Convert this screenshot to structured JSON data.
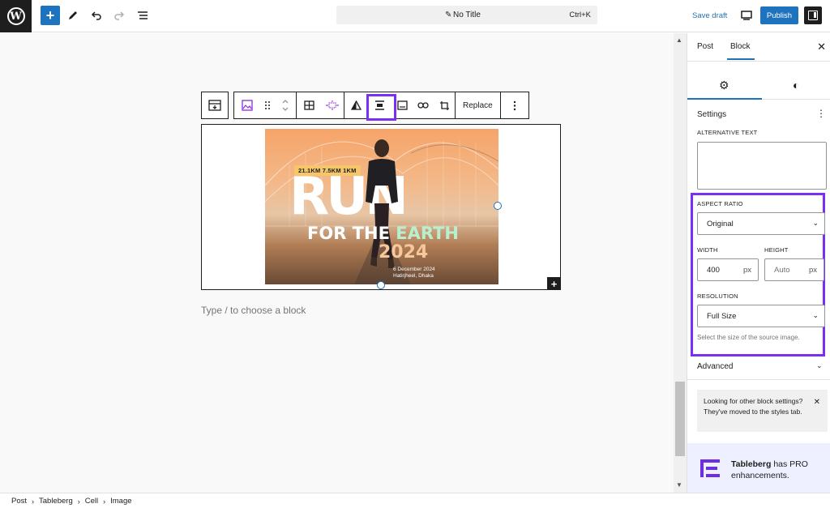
{
  "header": {
    "logo_letter": "W",
    "inserter_glyph": "+",
    "doc_title": "No Title",
    "shortcut": "Ctrl+K",
    "save_draft": "Save draft",
    "publish": "Publish"
  },
  "toolbar": {
    "replace_label": "Replace"
  },
  "image": {
    "distances": "21.1KM  7.5KM  1KM",
    "headline_1": "RUN",
    "headline_2_white": "FOR THE ",
    "headline_2_green": "EARTH",
    "year": "2024",
    "date_line": "6 December 2024",
    "place_line": "Hatirjheel, Dhaka"
  },
  "canvas": {
    "placeholder": "Type / to choose a block"
  },
  "sidebar": {
    "tabs": [
      {
        "label": "Post"
      },
      {
        "label": "Block"
      }
    ],
    "settings_header": "Settings",
    "alt_text_label": "ALTERNATIVE TEXT",
    "aspect_ratio_label": "ASPECT RATIO",
    "aspect_ratio_value": "Original",
    "width_label": "WIDTH",
    "width_value": "400",
    "height_label": "HEIGHT",
    "height_placeholder": "Auto",
    "unit": "px",
    "resolution_label": "RESOLUTION",
    "resolution_value": "Full Size",
    "resolution_help": "Select the size of the source image.",
    "advanced_label": "Advanced",
    "notice_text": "Looking for other block settings? They've moved to the styles tab.",
    "pro_brand": "Tableberg",
    "pro_text_rest": " has PRO enhancements."
  },
  "breadcrumb": [
    "Post",
    "Tableberg",
    "Cell",
    "Image"
  ],
  "colors": {
    "accent": "#1e73be",
    "highlight": "#7b2ff2",
    "dark": "#1e1e1e"
  }
}
